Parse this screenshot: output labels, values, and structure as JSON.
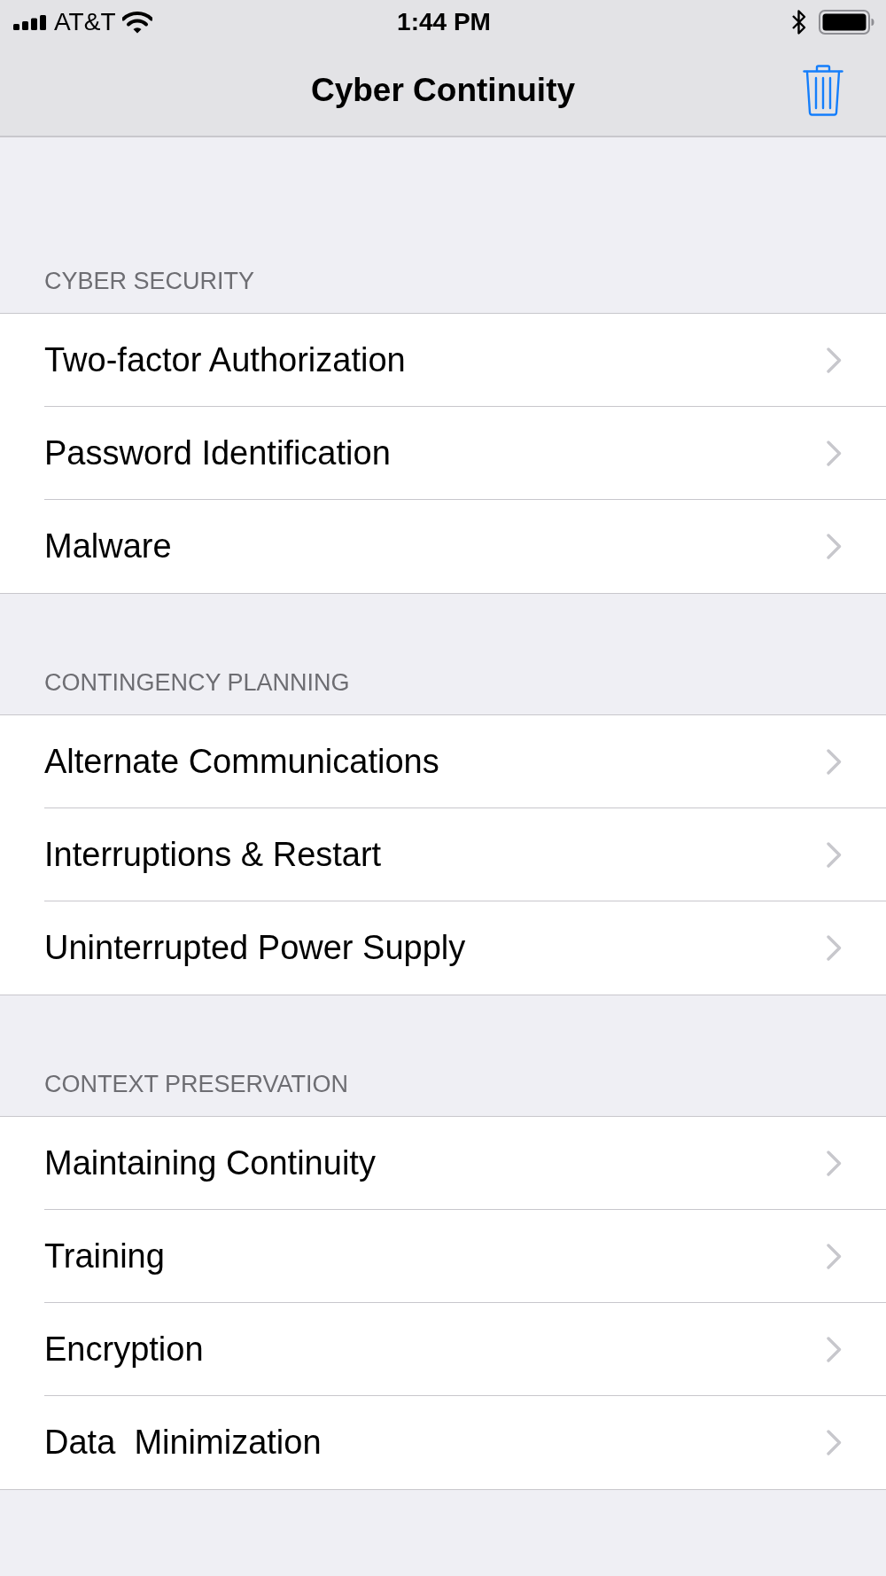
{
  "status_bar": {
    "carrier": "AT&T",
    "time": "1:44 PM"
  },
  "nav_bar": {
    "title": "Cyber Continuity"
  },
  "sections": [
    {
      "header": "CYBER SECURITY",
      "rows": [
        {
          "label": "Two-factor Authorization"
        },
        {
          "label": "Password Identification"
        },
        {
          "label": "Malware"
        }
      ]
    },
    {
      "header": "CONTINGENCY PLANNING",
      "rows": [
        {
          "label": "Alternate Communications"
        },
        {
          "label": "Interruptions & Restart"
        },
        {
          "label": "Uninterrupted Power Supply"
        }
      ]
    },
    {
      "header": "CONTEXT PRESERVATION",
      "rows": [
        {
          "label": "Maintaining Continuity"
        },
        {
          "label": "Training"
        },
        {
          "label": "Encryption"
        },
        {
          "label": "Data  Minimization"
        }
      ]
    }
  ]
}
